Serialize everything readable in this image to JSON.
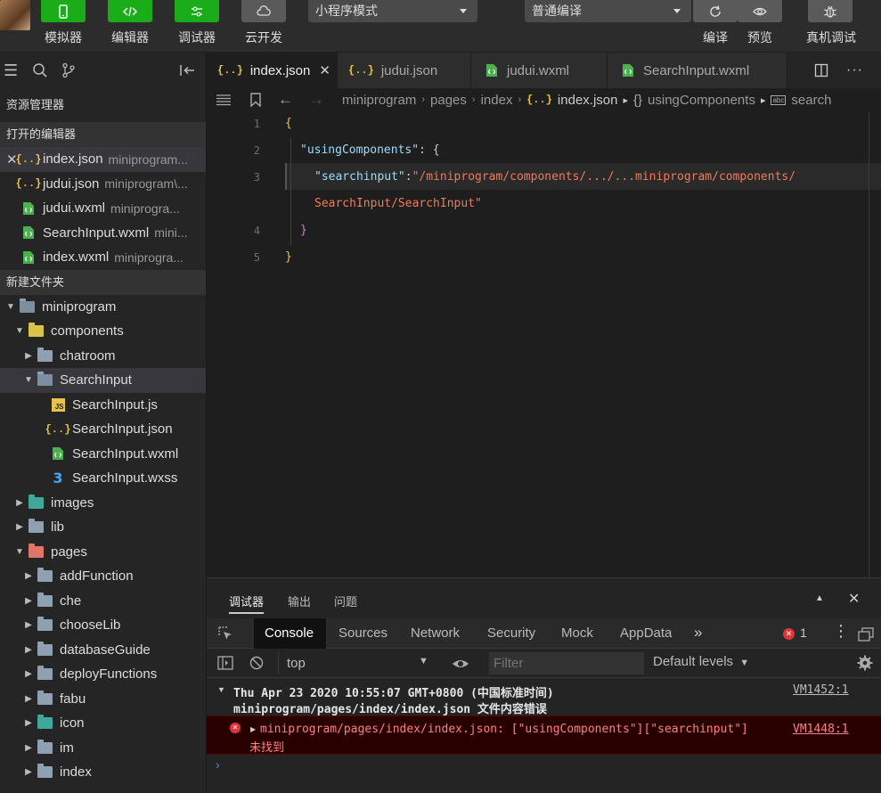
{
  "toolbar": {
    "buttons": [
      {
        "label": "模拟器"
      },
      {
        "label": "编辑器"
      },
      {
        "label": "调试器"
      },
      {
        "label": "云开发"
      }
    ],
    "mode_select": "小程序模式",
    "compile_select": "普通编译",
    "right_buttons": [
      {
        "label": "编译"
      },
      {
        "label": "预览"
      },
      {
        "label": "真机调试"
      }
    ]
  },
  "explorer": {
    "title": "资源管理器",
    "open_editors_title": "打开的编辑器",
    "open_editors": [
      {
        "name": "index.json",
        "path": "miniprogram..."
      },
      {
        "name": "judui.json",
        "path": "miniprogram\\..."
      },
      {
        "name": "judui.wxml",
        "path": "miniprogra..."
      },
      {
        "name": "SearchInput.wxml",
        "path": "mini..."
      },
      {
        "name": "index.wxml",
        "path": "miniprogra..."
      }
    ],
    "folder_title": "新建文件夹",
    "tree": {
      "root": "miniprogram",
      "components": "components",
      "chatroom": "chatroom",
      "searchinput": "SearchInput",
      "files": [
        "SearchInput.js",
        "SearchInput.json",
        "SearchInput.wxml",
        "SearchInput.wxss"
      ],
      "images": "images",
      "lib": "lib",
      "pages": "pages",
      "page_folders": [
        "addFunction",
        "che",
        "chooseLib",
        "databaseGuide",
        "deployFunctions",
        "fabu",
        "icon",
        "im",
        "index"
      ]
    }
  },
  "editor": {
    "tabs": [
      "index.json",
      "judui.json",
      "judui.wxml",
      "SearchInput.wxml"
    ],
    "breadcrumb": [
      "miniprogram",
      "pages",
      "index",
      "index.json",
      "usingComponents",
      "search"
    ],
    "line_numbers": [
      "1",
      "2",
      "3",
      "4",
      "5"
    ],
    "code": {
      "l1": "{",
      "l2_key": "\"usingComponents\"",
      "l2_rest": ": {",
      "l3_key": "\"searchinput\"",
      "l3_val": "\"/miniprogram/components/.../...miniprogram/components/",
      "l3_cont": "SearchInput/SearchInput\"",
      "l4": "}",
      "l5": "}"
    }
  },
  "debugger": {
    "tabs": [
      "调试器",
      "输出",
      "问题"
    ],
    "devtools_tabs": [
      "Console",
      "Sources",
      "Network",
      "Security",
      "Mock",
      "AppData"
    ],
    "error_count": "1",
    "context": "top",
    "filter_placeholder": "Filter",
    "levels": "Default levels",
    "group_header": "Thu Apr 23 2020 10:55:07 GMT+0800 (中国标准时间)",
    "group_sub": "miniprogram/pages/index/index.json 文件内容错误",
    "group_link": "VM1452:1",
    "error_text": "miniprogram/pages/index/index.json: [\"usingComponents\"][\"searchinput\"]",
    "error_text2": "未找到",
    "error_link": "VM1448:1"
  }
}
